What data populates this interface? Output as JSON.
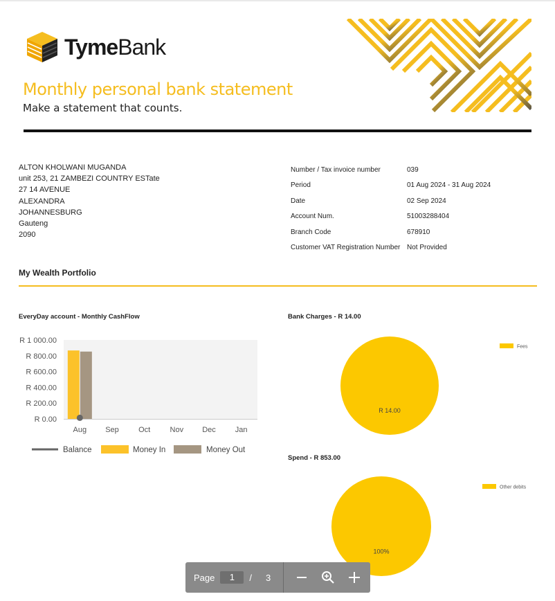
{
  "brand": {
    "name_bold": "Tyme",
    "name_regular": "Bank"
  },
  "statement": {
    "title": "Monthly personal bank statement",
    "subtitle": "Make a statement that counts."
  },
  "customer": {
    "name": "ALTON KHOLWANI MUGANDA",
    "line1": "unit 253, 21 ZAMBEZI COUNTRY ESTate",
    "line2": "27 14 AVENUE",
    "line3": "ALEXANDRA",
    "line4": "JOHANNESBURG",
    "line5": "Gauteng",
    "line6": "2090"
  },
  "meta": [
    {
      "label": "Number / Tax invoice number",
      "value": "039"
    },
    {
      "label": "Period",
      "value": "01 Aug 2024 - 31 Aug 2024"
    },
    {
      "label": "Date",
      "value": "02 Sep 2024"
    },
    {
      "label": "Account Num.",
      "value": "51003288404"
    },
    {
      "label": "Branch Code",
      "value": "678910"
    },
    {
      "label": "Customer VAT Registration Number",
      "value": "Not Provided"
    }
  ],
  "section_title": "My Wealth Portfolio",
  "colors": {
    "accent": "#f5bd1f",
    "money_in": "#fcc22a",
    "money_out": "#a59682",
    "balance": "#666666",
    "pie": "#fcc800"
  },
  "chart_data": [
    {
      "type": "bar",
      "title": "EveryDay account - Monthly CashFlow",
      "categories": [
        "Aug",
        "Sep",
        "Oct",
        "Nov",
        "Dec",
        "Jan"
      ],
      "series": [
        {
          "name": "Money In",
          "values": [
            867,
            0,
            0,
            0,
            0,
            0
          ]
        },
        {
          "name": "Money Out",
          "values": [
            853,
            0,
            0,
            0,
            0,
            0
          ]
        },
        {
          "name": "Balance",
          "values": [
            14,
            null,
            null,
            null,
            null,
            null
          ]
        }
      ],
      "yticks": [
        "R 0.00",
        "R 200.00",
        "R 400.00",
        "R 600.00",
        "R 800.00",
        "R 1 000.00"
      ],
      "ylim": [
        0,
        1000
      ],
      "legend_position": "bottom"
    },
    {
      "type": "pie",
      "title": "Bank Charges - R 14.00",
      "labels": [
        "Fees"
      ],
      "values": [
        14
      ],
      "slice_labels": [
        "R 14.00"
      ],
      "legend_position": "right"
    },
    {
      "type": "pie",
      "title": "Spend - R 853.00",
      "labels": [
        "Other debits"
      ],
      "values": [
        853
      ],
      "slice_labels": [
        "100%"
      ],
      "legend_position": "right"
    }
  ],
  "pager": {
    "label": "Page",
    "current": "1",
    "separator": "/",
    "total": "3"
  }
}
